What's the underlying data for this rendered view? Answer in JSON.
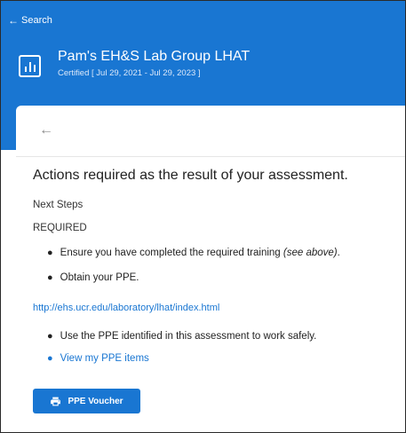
{
  "nav": {
    "back_label": "Search"
  },
  "header": {
    "title": "Pam's EH&S Lab Group LHAT",
    "subtitle": "Certified [ Jul 29, 2021 - Jul 29, 2023 ]"
  },
  "content": {
    "heading": "Actions required as the result of your assessment.",
    "next_steps": "Next Steps",
    "required": "REQUIRED",
    "bullet1_text": "Ensure you have completed the required training ",
    "bullet1_italic": "(see above)",
    "bullet1_end": ".",
    "bullet2": "Obtain your PPE.",
    "url": "http://ehs.ucr.edu/laboratory/lhat/index.html",
    "bullet3": "Use the PPE identified in this assessment to work safely.",
    "bullet4_link": "View my PPE items"
  },
  "button": {
    "label": "PPE Voucher"
  },
  "colors": {
    "accent": "#1976d2"
  },
  "icons": {
    "group": "bar-chart-icon",
    "button": "printer-icon"
  }
}
